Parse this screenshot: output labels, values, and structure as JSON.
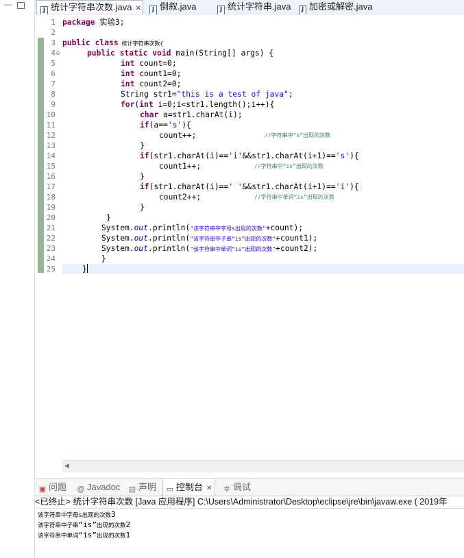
{
  "editor_tabs": [
    {
      "label": "统计字符串次数.java",
      "active": true
    },
    {
      "label": "倒叙.java",
      "active": false
    },
    {
      "label": "统计字符串.java",
      "active": false
    },
    {
      "label": "加密或解密.java",
      "active": false
    }
  ],
  "line_numbers": [
    "1",
    "2",
    "3",
    "4",
    "5",
    "6",
    "7",
    "8",
    "9",
    "10",
    "11",
    "12",
    "13",
    "14",
    "15",
    "16",
    "17",
    "18",
    "19",
    "20",
    "21",
    "22",
    "23",
    "24",
    "25"
  ],
  "code": {
    "l1_kw": "package",
    "l1_rest": " 实验3;",
    "l3_kw1": "public",
    "l3_kw2": "class",
    "l3_name": " 统计字符串次数{",
    "l4_kw1": "public",
    "l4_kw2": "static",
    "l4_kw3": "void",
    "l4_rest": " main(String[] args) {",
    "l5_kw": "int",
    "l5_rest": " count=0;",
    "l6_kw": "int",
    "l6_rest": " count1=0;",
    "l7_kw": "int",
    "l7_rest": " count2=0;",
    "l8_a": "String str1=",
    "l8_str": "\"this is a test of java\"",
    "l8_b": ";",
    "l9_kw1": "for",
    "l9_a": "(",
    "l9_kw2": "int",
    "l9_b": " i=0;i<str1.length();i++){",
    "l10_kw": "char",
    "l10_rest": " a=str1.charAt(i);",
    "l11_kw": "if",
    "l11_a": "(a==",
    "l11_str": "'s'",
    "l11_b": "){",
    "l12_a": "count++;",
    "l12_cmt": "//字符串中“s”出现的次数",
    "l13": "}",
    "l14_kw": "if",
    "l14_a": "(str1.charAt(i)==",
    "l14_s1": "'i'",
    "l14_b": "&&str1.charAt(i+1)==",
    "l14_s2": "'s'",
    "l14_c": "){",
    "l15_a": "count1++;",
    "l15_cmt": "//字符串中“is”出现的次数",
    "l16": "}",
    "l17_kw": "if",
    "l17_a": "(str1.charAt(i)==",
    "l17_s1": "' '",
    "l17_b": "&&str1.charAt(i+1)==",
    "l17_s2": "'i'",
    "l17_c": "){",
    "l18_a": "count2++;",
    "l18_cmt": "//字符串中单词“is”出现的次数",
    "l19": "}",
    "l20": "}",
    "l21_a": "System.",
    "l21_fld": "out",
    "l21_b": ".println(",
    "l21_str": "\"该字符串中字母s出现的次数\"",
    "l21_c": "+count);",
    "l22_a": "System.",
    "l22_fld": "out",
    "l22_b": ".println(",
    "l22_str": "\"该字符串中子串“is”出现的次数\"",
    "l22_c": "+count1);",
    "l23_a": "System.",
    "l23_fld": "out",
    "l23_b": ".println(",
    "l23_str": "\"该字符串中单词“is”出现的次数\"",
    "l23_c": "+count2);",
    "l24": "}",
    "l25": "}"
  },
  "console_tabs": [
    {
      "label": "问题",
      "icon": "problems-icon"
    },
    {
      "label": "Javadoc",
      "icon": "at-icon"
    },
    {
      "label": "声明",
      "icon": "declaration-icon"
    },
    {
      "label": "控制台",
      "icon": "console-icon",
      "active": true
    },
    {
      "label": "调试",
      "icon": "debug-icon"
    }
  ],
  "console_header": "<已终止> 统计字符串次数 [Java 应用程序] C:\\Users\\Administrator\\Desktop\\eclipse\\jre\\bin\\javaw.exe ( 2019年",
  "console_output": {
    "o1_a": "该字符串中字母s出现的次数",
    "o1_b": "3",
    "o2_a": "该字符串中子串",
    "o2_big": "“is”",
    "o2_b": "出现的次数",
    "o2_c": "2",
    "o3_a": "该字符串中单词",
    "o3_big": "“is”",
    "o3_b": "出现的次数",
    "o3_c": "1"
  },
  "colors": {
    "keyword": "#7f0055",
    "string": "#2a00ff",
    "comment": "#3f7f5f",
    "field": "#0000c0",
    "current_line": "#e8f2fe"
  }
}
